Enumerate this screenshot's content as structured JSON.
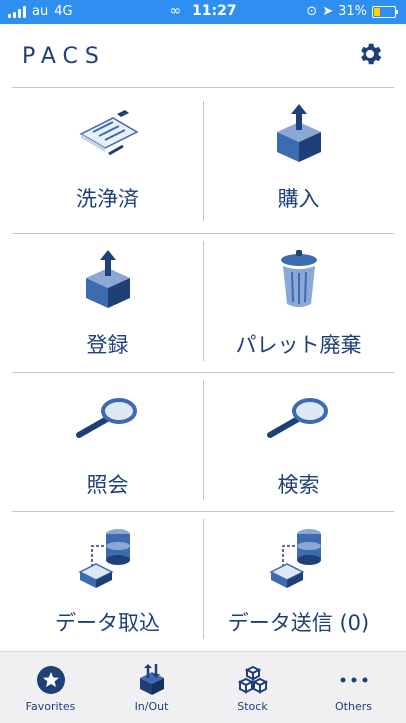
{
  "status_bar": {
    "carrier": "au",
    "network": "4G",
    "time": "11:27",
    "battery": "31%",
    "battery_level": 0.31
  },
  "header": {
    "logo": "PACS"
  },
  "menu": [
    {
      "label": "洗浄済",
      "icon": "clipboard-checklist-icon"
    },
    {
      "label": "購入",
      "icon": "box-upload-icon"
    },
    {
      "label": "登録",
      "icon": "box-upload-icon"
    },
    {
      "label": "パレット廃棄",
      "icon": "trash-can-icon"
    },
    {
      "label": "照会",
      "icon": "magnifier-icon"
    },
    {
      "label": "検索",
      "icon": "magnifier-icon"
    },
    {
      "label": "データ取込",
      "icon": "database-import-icon"
    },
    {
      "label": "データ送信 (0)",
      "icon": "database-send-icon"
    }
  ],
  "tabs": [
    {
      "label": "Favorites",
      "icon": "star-icon"
    },
    {
      "label": "In/Out",
      "icon": "in-out-box-icon"
    },
    {
      "label": "Stock",
      "icon": "stacked-boxes-icon"
    },
    {
      "label": "Others",
      "icon": "more-dots-icon"
    }
  ],
  "colors": {
    "status_bar": "#2f8ff0",
    "brand": "#1f3f77",
    "accent": "#3d6bb0",
    "divider": "#b9c7da",
    "tab_bar": "#f0f0f2"
  }
}
